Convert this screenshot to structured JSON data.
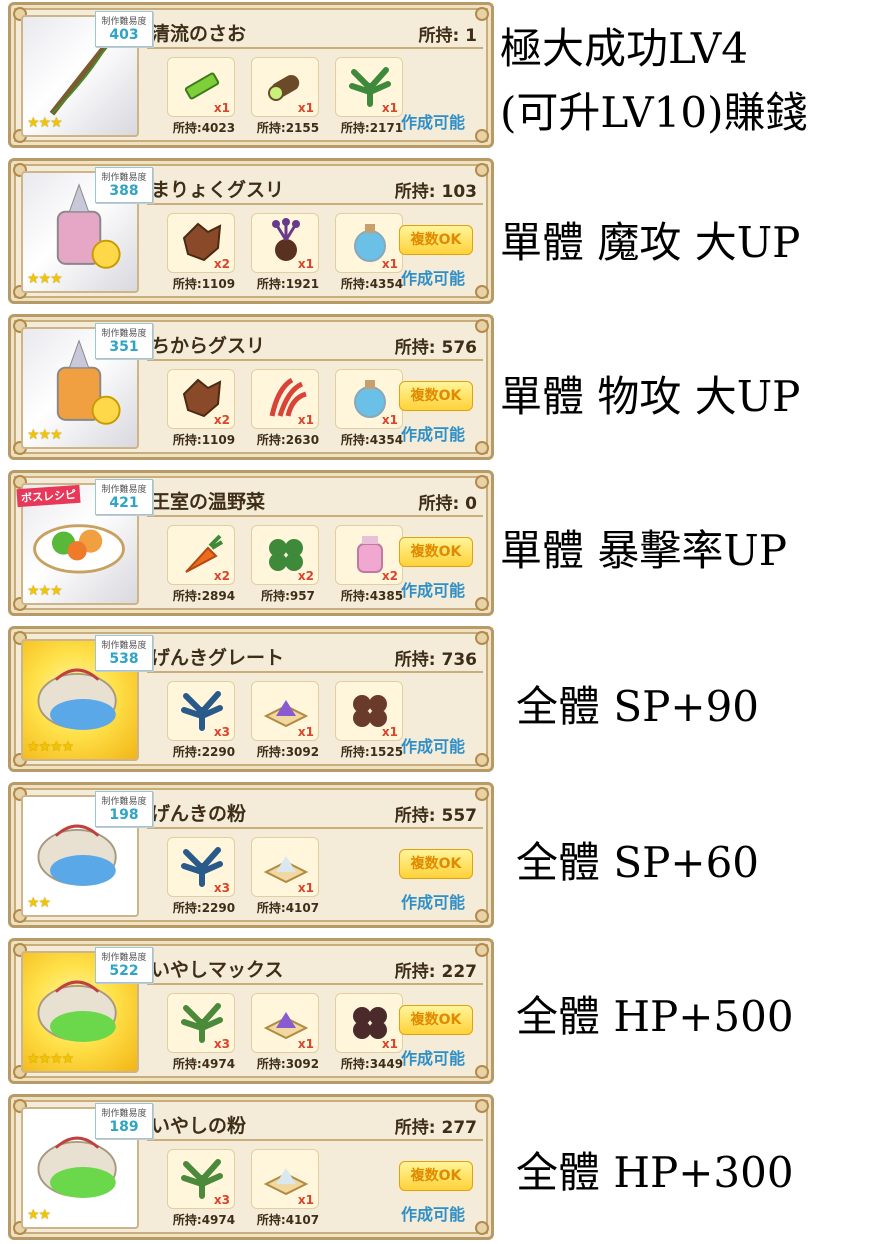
{
  "common": {
    "difficulty_label": "制作難易度",
    "multi_ok": "複数OK",
    "craftable": "作成可能"
  },
  "cards": [
    {
      "name": "清流のさお",
      "owned": "所持: 1",
      "difficulty": "403",
      "stars": "★★★",
      "thumb_style": "silver",
      "boss": "",
      "show_multi": false,
      "tint": "#7a5a2e",
      "note_lines": [
        "極大成功LV4",
        "(可升LV10)賺錢"
      ],
      "materials": [
        {
          "icon": "green-stick-icon",
          "qty": "x1",
          "count": "所持:4023",
          "color": "#7fcf3a"
        },
        {
          "icon": "log-icon",
          "qty": "x1",
          "count": "所持:2155",
          "color": "#6b4a2a"
        },
        {
          "icon": "herb-leaf-icon",
          "qty": "x1",
          "count": "所持:2171",
          "color": "#3f8a3a"
        }
      ]
    },
    {
      "name": "まりょくグスリ",
      "owned": "所持: 103",
      "difficulty": "388",
      "stars": "★★★",
      "thumb_style": "silver",
      "boss": "",
      "show_multi": true,
      "tint": "#e6a6c6",
      "note_lines": [
        "單體 魔攻 大UP"
      ],
      "materials": [
        {
          "icon": "rock-bark-icon",
          "qty": "x2",
          "count": "所持:1109",
          "color": "#8a4a2a"
        },
        {
          "icon": "purple-flower-icon",
          "qty": "x1",
          "count": "所持:1921",
          "color": "#6a3a8a"
        },
        {
          "icon": "water-flask-icon",
          "qty": "x1",
          "count": "所持:4354",
          "color": "#6ac0e6"
        }
      ]
    },
    {
      "name": "ちからグスリ",
      "owned": "所持: 576",
      "difficulty": "351",
      "stars": "★★★",
      "thumb_style": "silver",
      "boss": "",
      "show_multi": true,
      "tint": "#f0a040",
      "note_lines": [
        "單體 物攻 大UP"
      ],
      "materials": [
        {
          "icon": "rock-bark-icon",
          "qty": "x2",
          "count": "所持:1109",
          "color": "#8a4a2a"
        },
        {
          "icon": "red-claw-icon",
          "qty": "x1",
          "count": "所持:2630",
          "color": "#d8443a"
        },
        {
          "icon": "water-flask-icon",
          "qty": "x1",
          "count": "所持:4354",
          "color": "#6ac0e6"
        }
      ]
    },
    {
      "name": "王室の温野菜",
      "owned": "所持: 0",
      "difficulty": "421",
      "stars": "★★★",
      "thumb_style": "silver",
      "boss": "ボスレシピ",
      "show_multi": true,
      "tint": "#58b83a",
      "note_lines": [
        "單體 暴擊率UP"
      ],
      "materials": [
        {
          "icon": "carrot-icon",
          "qty": "x2",
          "count": "所持:2894",
          "color": "#ee6a1e"
        },
        {
          "icon": "broccoli-icon",
          "qty": "x2",
          "count": "所持:957",
          "color": "#3f8a3a"
        },
        {
          "icon": "milk-jar-icon",
          "qty": "x2",
          "count": "所持:4385",
          "color": "#f0a8d0"
        }
      ]
    },
    {
      "name": "げんきグレート",
      "owned": "所持: 736",
      "difficulty": "538",
      "stars": "★★★★",
      "thumb_style": "gold",
      "boss": "",
      "show_multi": false,
      "tint": "#5aa8e8",
      "note_lines": [
        "全體 SP+90"
      ],
      "materials": [
        {
          "icon": "blue-herb-icon",
          "qty": "x3",
          "count": "所持:2290",
          "color": "#2a5a8a"
        },
        {
          "icon": "purple-powder-icon",
          "qty": "x1",
          "count": "所持:3092",
          "color": "#8a5ad0"
        },
        {
          "icon": "dark-berry-icon",
          "qty": "x1",
          "count": "所持:1525",
          "color": "#6a3a2a"
        }
      ]
    },
    {
      "name": "げんきの粉",
      "owned": "所持: 557",
      "difficulty": "198",
      "stars": "★★",
      "thumb_style": "white",
      "boss": "",
      "show_multi": true,
      "tint": "#5aa8e8",
      "note_lines": [
        "全體 SP+60"
      ],
      "materials": [
        {
          "icon": "blue-herb-icon",
          "qty": "x3",
          "count": "所持:2290",
          "color": "#2a5a8a"
        },
        {
          "icon": "white-powder-icon",
          "qty": "x1",
          "count": "所持:4107",
          "color": "#d8e8ee"
        }
      ]
    },
    {
      "name": "いやしマックス",
      "owned": "所持: 227",
      "difficulty": "522",
      "stars": "★★★★",
      "thumb_style": "gold",
      "boss": "",
      "show_multi": true,
      "tint": "#6ad84a",
      "note_lines": [
        "全體 HP+500"
      ],
      "materials": [
        {
          "icon": "green-herb-icon",
          "qty": "x3",
          "count": "所持:4974",
          "color": "#4a8a3a"
        },
        {
          "icon": "purple-powder-icon",
          "qty": "x1",
          "count": "所持:3092",
          "color": "#8a5ad0"
        },
        {
          "icon": "dark-berry-icon",
          "qty": "x1",
          "count": "所持:3449",
          "color": "#4a2a2a"
        }
      ]
    },
    {
      "name": "いやしの粉",
      "owned": "所持: 277",
      "difficulty": "189",
      "stars": "★★",
      "thumb_style": "white",
      "boss": "",
      "show_multi": true,
      "tint": "#6ad84a",
      "note_lines": [
        "全體 HP+300"
      ],
      "materials": [
        {
          "icon": "green-herb-icon",
          "qty": "x3",
          "count": "所持:4974",
          "color": "#4a8a3a"
        },
        {
          "icon": "white-powder-icon",
          "qty": "x1",
          "count": "所持:4107",
          "color": "#d8e8ee"
        }
      ]
    }
  ]
}
